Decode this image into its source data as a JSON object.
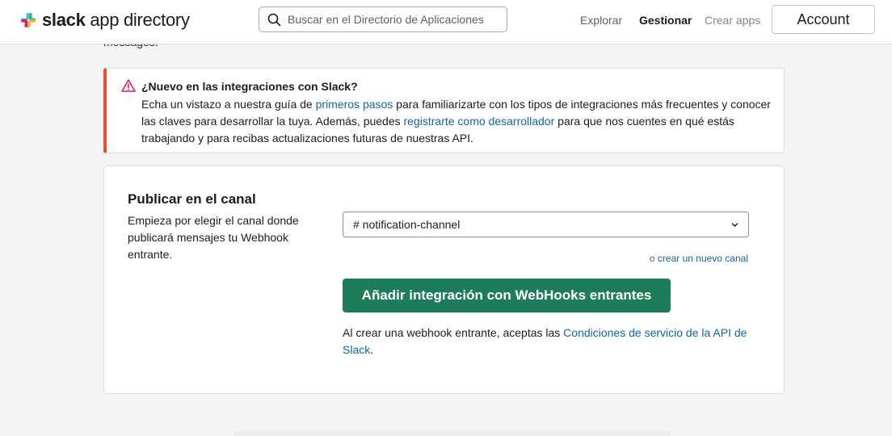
{
  "header": {
    "brand_bold": "slack",
    "brand_rest": "app directory",
    "search_placeholder": "Buscar en el Directorio de Aplicaciones",
    "nav": {
      "explore": "Explorar",
      "manage": "Gestionar",
      "create": "Crear apps"
    },
    "account": "Account"
  },
  "clipped_text": "messages.",
  "notice": {
    "title": "¿Nuevo en las integraciones con Slack?",
    "text_1": "Echa un vistazo a nuestra guía de ",
    "link_1": "primeros pasos",
    "text_2": " para familiarizarte con los tipos de integraciones más frecuentes y conocer las claves para desarrollar la tuya. Además, puedes ",
    "link_2": "registrarte como desarrollador",
    "text_3": " para que nos cuentes en qué estás trabajando y para recibas actualizaciones futuras de nuestras API.",
    "accent_color": "#e8512a"
  },
  "card": {
    "title": "Publicar en el canal",
    "description": "Empieza por elegir el canal donde publicará mensajes tu Webhook entrante.",
    "channel_selected": "# notification-channel",
    "or_text": "o ",
    "new_channel_link": "crear un nuevo canal",
    "add_button": "Añadir integración con WebHooks entrantes",
    "terms_text": "Al crear una webhook entrante, aceptas las ",
    "terms_link": "Condiciones de servicio de la API de Slack",
    "terms_end": ".",
    "button_color": "#1d7c5a",
    "link_color": "#1264a3"
  }
}
